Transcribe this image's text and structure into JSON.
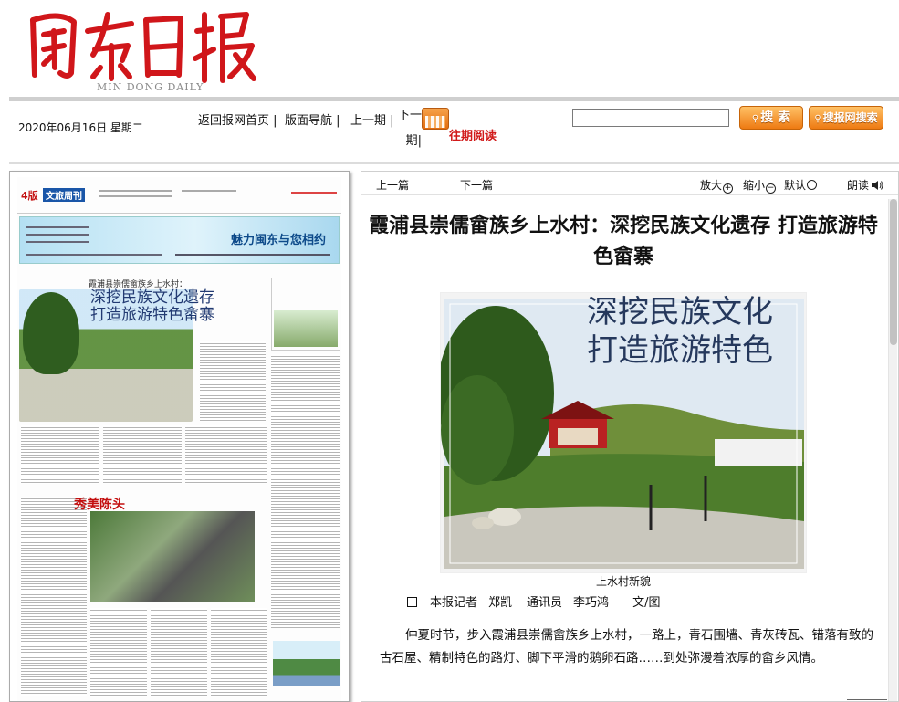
{
  "masthead": {
    "logo_text": "闽东日报",
    "logo_subtitle": "MIN DONG DAILY"
  },
  "toolbar": {
    "date": "2020年06月16日  星期二",
    "nav": {
      "home": "返回报网首页",
      "sections": "版面导航",
      "prev_issue": "上一期",
      "next_issue": "下一期"
    },
    "archive_label": "往期阅读",
    "search_placeholder": "",
    "search_button": "搜 索",
    "search_site_button": "搜报网搜索"
  },
  "paper_thumb": {
    "page_no": "4版",
    "section": "文旅周刊",
    "banner_text": "魅力闽东与您相约",
    "kicker": "霞浦县崇儒畲族乡上水村：",
    "headline_line1": "深挖民族文化遗存",
    "headline_line2": "打造旅游特色畲寨",
    "feature_title": "秀美陈头"
  },
  "article": {
    "toolbar": {
      "prev": "上一篇",
      "next": "下一篇",
      "zoom_in": "放大",
      "zoom_out": "缩小",
      "default": "默认",
      "read_aloud": "朗读"
    },
    "title": "霞浦县崇儒畲族乡上水村：深挖民族文化遗存  打造旅游特色畲寨",
    "photo_overlay_line1": "深挖民族文化",
    "photo_overlay_line2": "打造旅游特色",
    "photo_caption": "上水村新貌",
    "byline": {
      "reporter_label": "本报记者",
      "reporter": "郑凯",
      "correspondent_label": "通讯员",
      "correspondent": "李巧鸿",
      "suffix": "文/图"
    },
    "body": "仲夏时节，步入霞浦县崇儒畲族乡上水村，一路上，青石围墙、青灰砖瓦、错落有致的古石屋、精制特色的路灯、脚下平滑的鹅卵石路……到处弥漫着浓厚的畲乡风情。"
  },
  "colors": {
    "logo_red": "#d0161a",
    "accent_orange": "#ee7a12",
    "archive_red": "#d11a1a"
  }
}
